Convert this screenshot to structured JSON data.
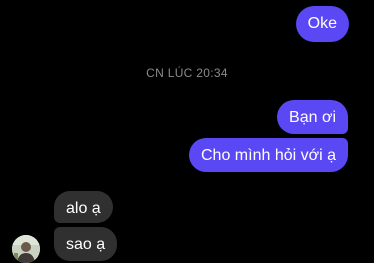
{
  "messages": {
    "oke": "Oke",
    "ban_oi": "Bạn ơi",
    "cho_minh": "Cho mình hỏi với ạ",
    "alo": "alo ạ",
    "sao": "sao ạ"
  },
  "timestamp": "CN LÚC 20:34",
  "colors": {
    "outgoing_bubble": "#5a48f5",
    "incoming_bubble": "#303030",
    "background": "#000000",
    "timestamp_text": "#8a8a8a"
  },
  "icons": {
    "avatar": "contact-avatar-icon"
  }
}
